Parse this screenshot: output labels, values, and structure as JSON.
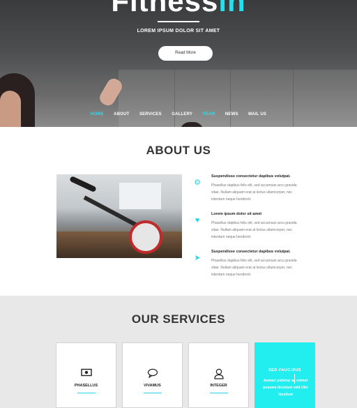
{
  "hero": {
    "title_main": "Fitness",
    "title_accent": "in",
    "subtitle": "LOREM IPSUM DOLOR SIT AMET",
    "button_label": "Read More"
  },
  "nav": {
    "items": [
      {
        "label": "HOME",
        "active": true
      },
      {
        "label": "ABOUT",
        "active": false
      },
      {
        "label": "SERVICES",
        "active": false
      },
      {
        "label": "GALLERY",
        "active": false
      },
      {
        "label": "TEAM",
        "active": true
      },
      {
        "label": "NEWS",
        "active": false
      },
      {
        "label": "MAIL US",
        "active": false
      }
    ]
  },
  "about": {
    "title": "ABOUT US",
    "features": [
      {
        "icon": "gear-icon",
        "heading": "Suspendisse consectetur dapibus volutpat.",
        "text": "Phasellus dapibus felis elit, sed accumsan arcu gravida vitae. Nullam aliquam erat at lectus ullamcorper, nec interdum neque hendrerit."
      },
      {
        "icon": "heart-icon",
        "heading": "Lorem ipsum dolor sit amet",
        "text": "Phasellus dapibus felis elit, sed accumsan arcu gravida vitae. Nullam aliquam erat at lectus ullamcorper, nec interdum neque hendrerit."
      },
      {
        "icon": "paper-plane-icon",
        "heading": "Suspendisse consectetur dapibus volutpat.",
        "text": "Phasellus dapibus felis elit, sed accumsan arcu gravida vitae. Nullam aliquam erat at lectus ullamcorper, nec interdum neque hendrerit."
      }
    ]
  },
  "services": {
    "title": "OUR SERVICES",
    "cards": [
      {
        "icon": "money-icon",
        "label": "PHASELLUS"
      },
      {
        "icon": "chat-bubble-icon",
        "label": "VIVAMUS"
      },
      {
        "icon": "user-icon",
        "label": "INTEGER"
      }
    ],
    "highlight": {
      "title": "SED FAUCIBUS",
      "text": "Aenean pulvinar ac enimet posuere tincidunt velit Utin tincidunt"
    }
  },
  "colors": {
    "accent": "#22e0f0"
  }
}
